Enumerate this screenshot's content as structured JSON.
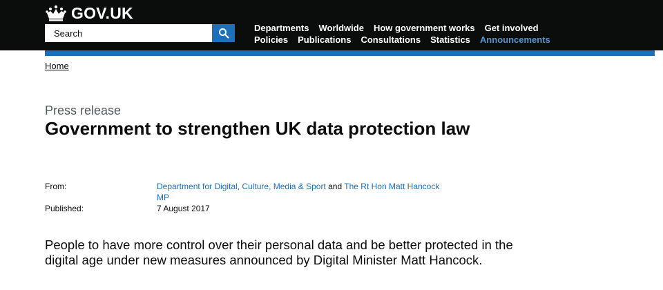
{
  "colors": {
    "header_bg": "#0b0c0c",
    "brand_blue": "#1d70b8",
    "active_nav": "#5694ca",
    "link": "#1d70b8",
    "secondary_text": "#505a5f"
  },
  "header": {
    "logo_text": "GOV.UK",
    "logo_icon": "crown-icon",
    "search": {
      "placeholder": "Search",
      "button_icon": "search-icon"
    },
    "nav_row_1": [
      "Departments",
      "Worldwide",
      "How government works",
      "Get involved"
    ],
    "nav_row_2": [
      "Policies",
      "Publications",
      "Consultations",
      "Statistics",
      "Announcements"
    ],
    "active_nav_item": "Announcements"
  },
  "breadcrumb": {
    "items": [
      "Home"
    ]
  },
  "document": {
    "type": "Press release",
    "title": "Government to strengthen UK data protection law",
    "from_label": "From:",
    "from_org_1": "Department for Digital, Culture, Media & Sport",
    "from_and": "and",
    "from_org_2": "The Rt Hon Matt Hancock MP",
    "published_label": "Published:",
    "published_date": "7 August 2017",
    "summary": "People to have more control over their personal data and be better protected in the digital age under new measures announced by Digital Minister Matt Hancock."
  }
}
